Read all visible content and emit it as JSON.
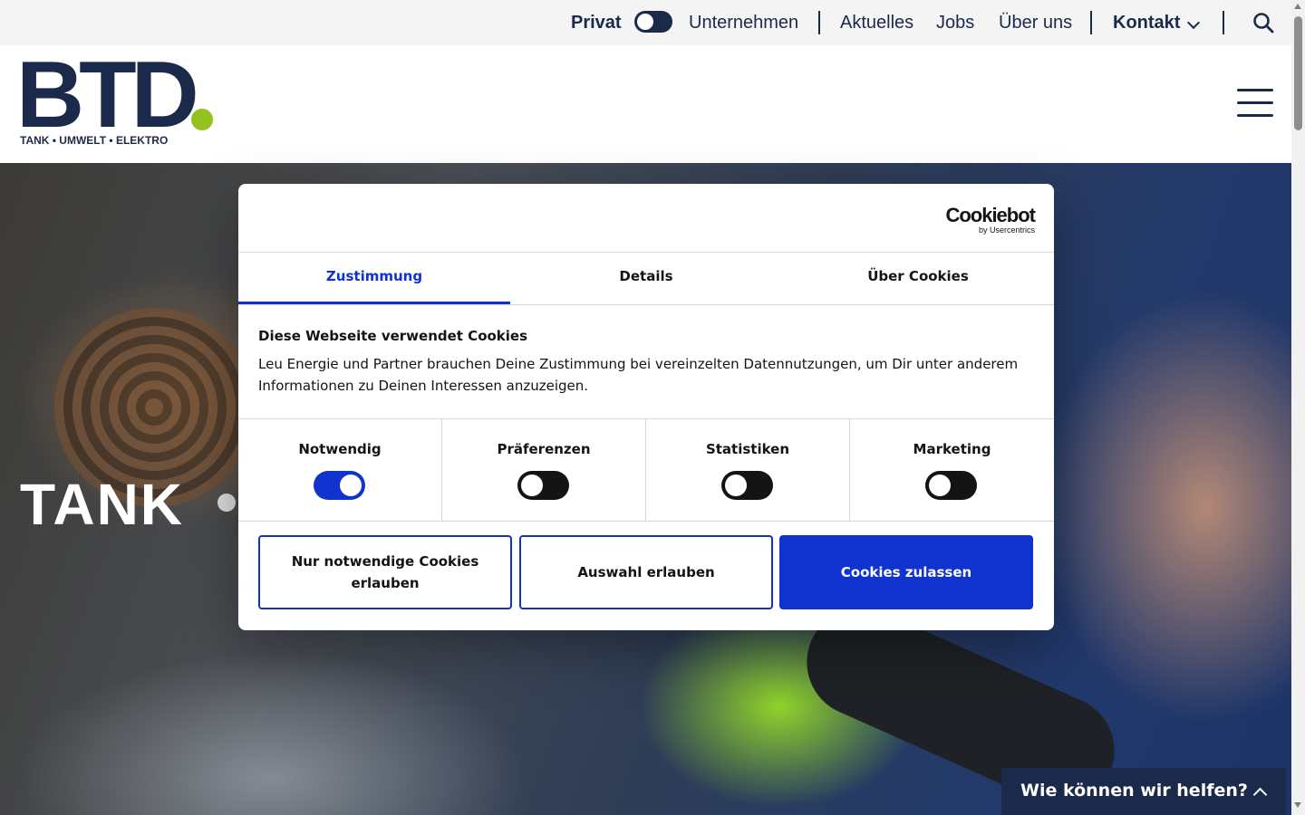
{
  "topbar": {
    "privat_label": "Privat",
    "unternehmen_label": "Unternehmen",
    "nav": [
      "Aktuelles",
      "Jobs",
      "Über uns"
    ],
    "kontakt_label": "Kontakt"
  },
  "header": {
    "logo_text": "BTD",
    "logo_tagline": "TANK • UMWELT • ELEKTRO"
  },
  "hero": {
    "title": "TANK"
  },
  "cookie_dialog": {
    "brand": "Cookiebot",
    "brand_sub": "by Usercentrics",
    "tabs": [
      {
        "label": "Zustimmung",
        "active": true
      },
      {
        "label": "Details",
        "active": false
      },
      {
        "label": "Über Cookies",
        "active": false
      }
    ],
    "heading": "Diese Webseite verwendet Cookies",
    "body": "Leu Energie und Partner brauchen Deine Zustimmung bei vereinzelten Datennutzungen, um Dir unter anderem Informationen zu Deinen Interessen anzuzeigen.",
    "categories": [
      {
        "label": "Notwendig",
        "enabled": true
      },
      {
        "label": "Präferenzen",
        "enabled": false
      },
      {
        "label": "Statistiken",
        "enabled": false
      },
      {
        "label": "Marketing",
        "enabled": false
      }
    ],
    "buttons": {
      "necessary_only": "Nur notwendige Cookies erlauben",
      "allow_selection": "Auswahl erlauben",
      "allow_all": "Cookies zulassen"
    }
  },
  "help_widget": {
    "label": "Wie können wir helfen?"
  },
  "colors": {
    "navy": "#1b2a4a",
    "brand_green": "#95c11f",
    "cookie_blue": "#1032cf"
  }
}
